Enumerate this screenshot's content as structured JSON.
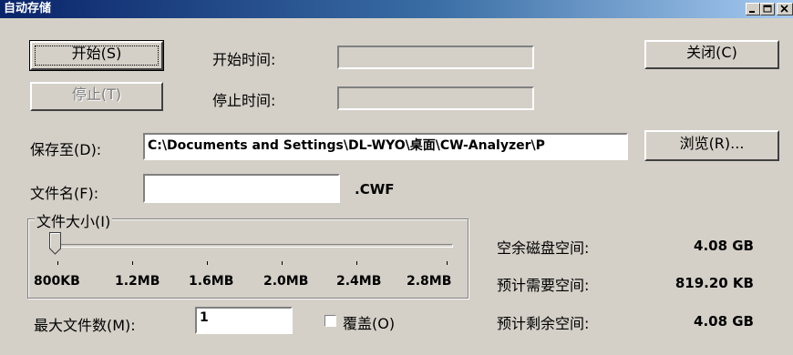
{
  "window": {
    "title": "自动存储"
  },
  "buttons": {
    "start": "开始(S)",
    "stop": "停止(T)",
    "close": "关闭(C)",
    "browse": "浏览(R)..."
  },
  "labels": {
    "start_time": "开始时间:",
    "stop_time": "停止时间:",
    "save_to": "保存至(D):",
    "file_name": "文件名(F):",
    "file_ext": ".CWF",
    "file_size_group": "文件大小(I)",
    "max_files": "最大文件数(M):",
    "overwrite": "覆盖(O)",
    "free_space": "空余磁盘空间:",
    "need_space": "预计需要空间:",
    "remain_space": "预计剩余空间:"
  },
  "fields": {
    "start_time_value": "",
    "stop_time_value": "",
    "save_path": "C:\\Documents and Settings\\DL-WYO\\桌面\\CW-Analyzer\\P",
    "file_name_value": "",
    "max_files_value": "1"
  },
  "slider": {
    "ticks": [
      "800KB",
      "1.2MB",
      "1.6MB",
      "2.0MB",
      "2.4MB",
      "2.8MB"
    ],
    "selected_index": 0
  },
  "checkbox": {
    "overwrite_checked": false
  },
  "disk": {
    "free_space": "4.08 GB",
    "need_space": "819.20 KB",
    "remain_space": "4.08 GB"
  }
}
